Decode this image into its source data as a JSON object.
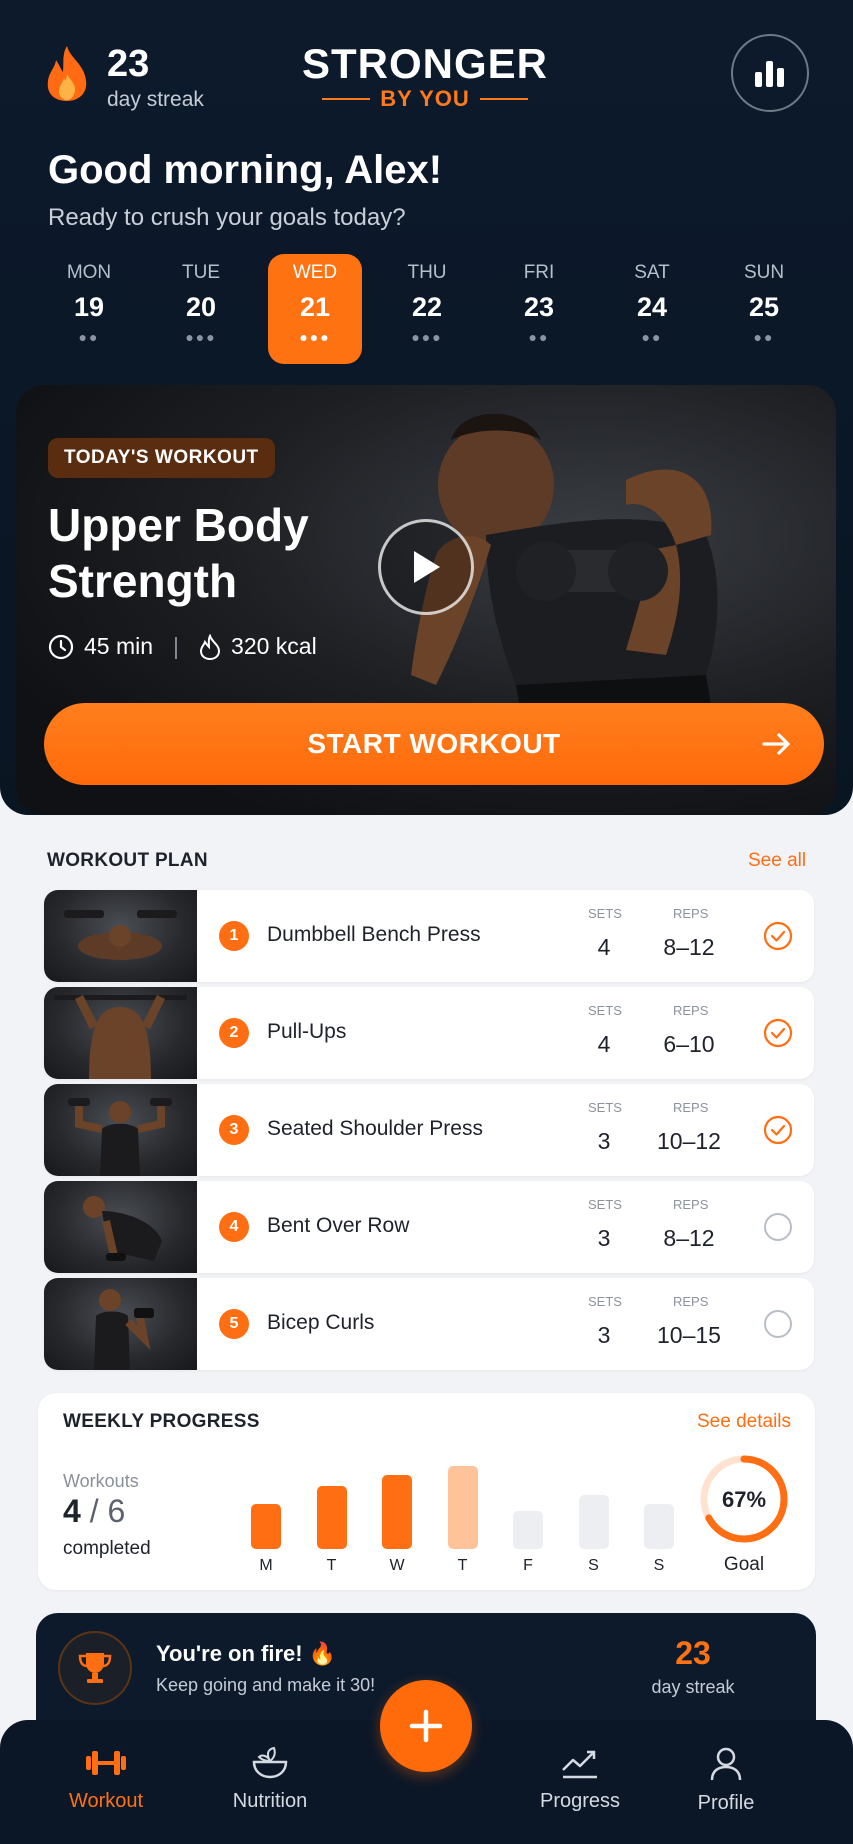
{
  "header": {
    "streak_count": "23",
    "streak_label": "day streak",
    "logo_line1": "STRONGER",
    "logo_line2": "BY YOU"
  },
  "greeting": {
    "title": "Good morning, Alex!",
    "subtitle": "Ready to crush your goals today?"
  },
  "week": [
    {
      "name": "MON",
      "date": "19",
      "dots": "●●"
    },
    {
      "name": "TUE",
      "date": "20",
      "dots": "●●●"
    },
    {
      "name": "WED",
      "date": "21",
      "dots": "●●●"
    },
    {
      "name": "THU",
      "date": "22",
      "dots": "●●●"
    },
    {
      "name": "FRI",
      "date": "23",
      "dots": "●●"
    },
    {
      "name": "SAT",
      "date": "24",
      "dots": "●●"
    },
    {
      "name": "SUN",
      "date": "25",
      "dots": "●●"
    }
  ],
  "today": {
    "tag": "TODAY'S WORKOUT",
    "title": "Upper Body Strength",
    "duration": "45 min",
    "calories": "320 kcal",
    "start_label": "START WORKOUT"
  },
  "plan": {
    "title": "WORKOUT PLAN",
    "see_all": "See all",
    "sets_label": "SETS",
    "reps_label": "REPS",
    "exercises": [
      {
        "num": "1",
        "name": "Dumbbell Bench Press",
        "sets": "4",
        "reps": "8–12",
        "done": true
      },
      {
        "num": "2",
        "name": "Pull-Ups",
        "sets": "4",
        "reps": "6–10",
        "done": true
      },
      {
        "num": "3",
        "name": "Seated Shoulder Press",
        "sets": "3",
        "reps": "10–12",
        "done": true
      },
      {
        "num": "4",
        "name": "Bent Over Row",
        "sets": "3",
        "reps": "8–12",
        "done": false
      },
      {
        "num": "5",
        "name": "Bicep Curls",
        "sets": "3",
        "reps": "10–15",
        "done": false
      }
    ]
  },
  "weekly": {
    "title": "WEEKLY PROGRESS",
    "see_details": "See details",
    "workouts_label": "Workouts",
    "done": "4",
    "total": "6",
    "completed_label": "completed",
    "goal_percent": "67%",
    "goal_fraction": 0.67,
    "goal_label": "Goal",
    "days": [
      "M",
      "T",
      "W",
      "T",
      "F",
      "S",
      "S"
    ],
    "levels": [
      0.5,
      0.7,
      0.82,
      0.92,
      0.42,
      0.6,
      0.5
    ],
    "states": [
      "done",
      "done",
      "done",
      "today",
      "upcoming",
      "upcoming",
      "upcoming"
    ]
  },
  "fire": {
    "title": "You're on fire! 🔥",
    "subtitle": "Keep going and make it 30!",
    "count": "23",
    "label": "day streak"
  },
  "nav": {
    "workout": "Workout",
    "nutrition": "Nutrition",
    "progress": "Progress",
    "profile": "Profile"
  },
  "colors": {
    "accent": "#ff6e12",
    "navy": "#0c1a2c",
    "bar_light": "#ffc39a",
    "bar_upcoming": "#eceef1"
  }
}
